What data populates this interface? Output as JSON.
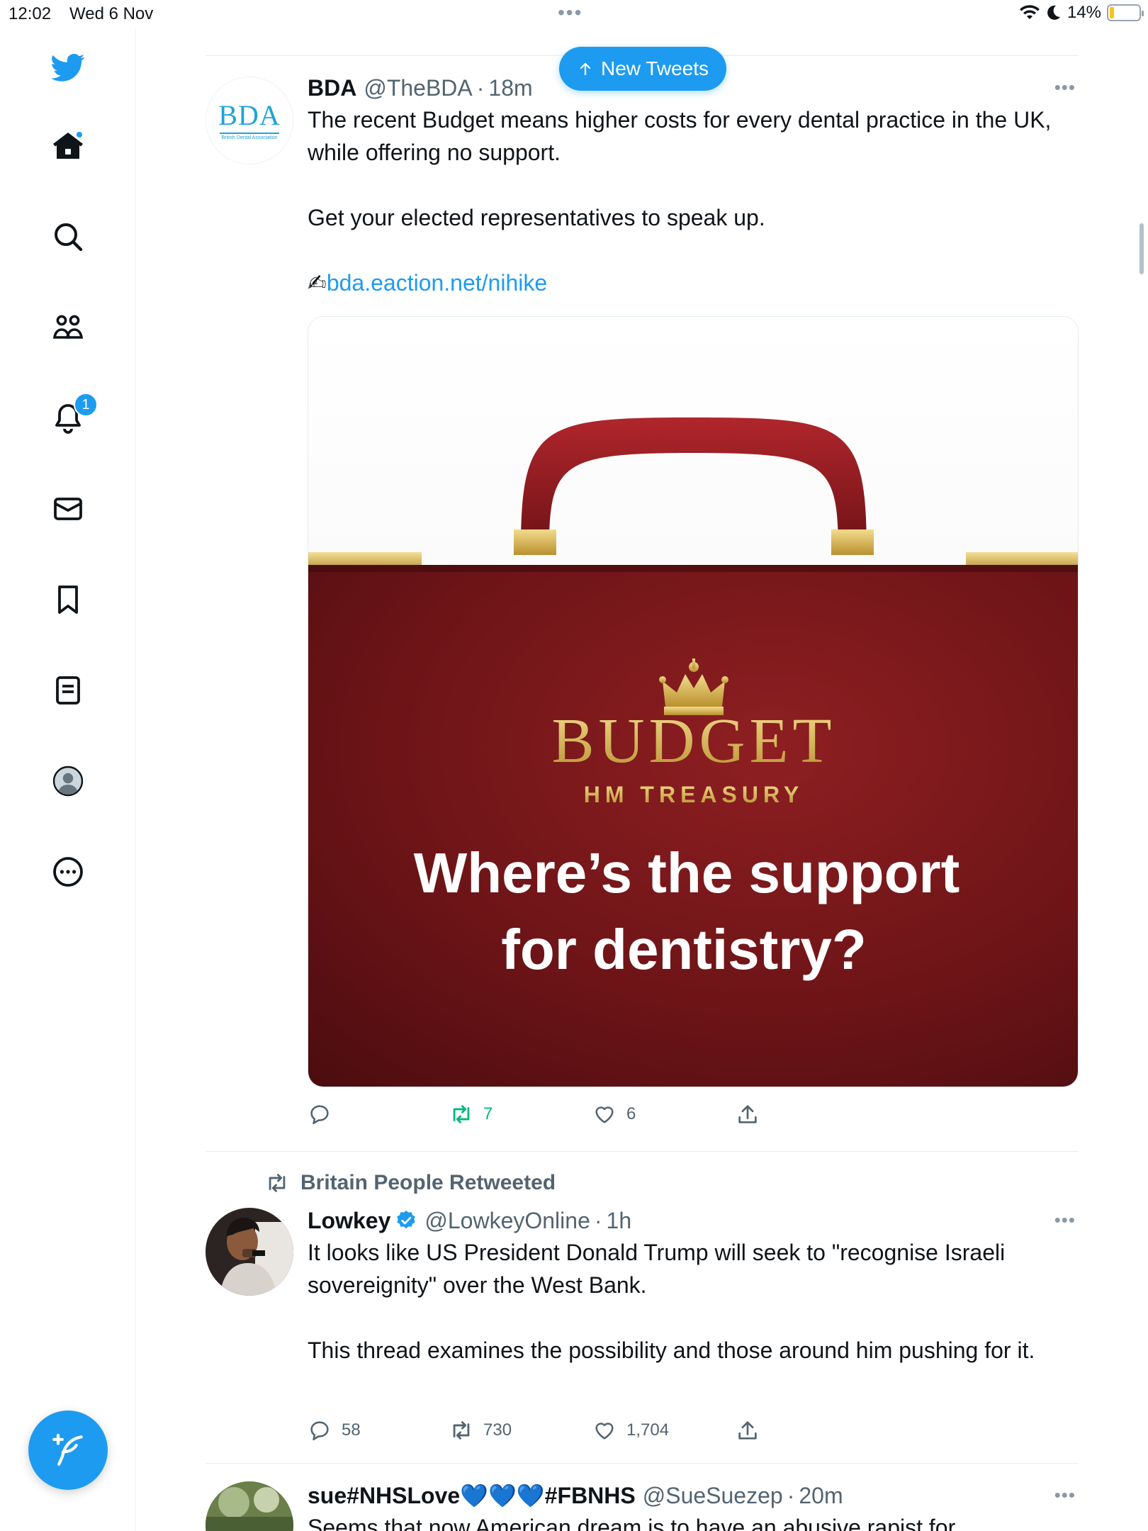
{
  "status_bar": {
    "time": "12:02",
    "date": "Wed 6 Nov",
    "battery_percent": "14%",
    "battery_level": 0.14
  },
  "sidebar": {
    "items": [
      {
        "name": "home",
        "icon": "home-icon",
        "has_dot": true
      },
      {
        "name": "explore",
        "icon": "search-icon"
      },
      {
        "name": "communities",
        "icon": "people-icon"
      },
      {
        "name": "notifications",
        "icon": "bell-icon",
        "badge": "1"
      },
      {
        "name": "messages",
        "icon": "envelope-icon"
      },
      {
        "name": "bookmarks",
        "icon": "bookmark-icon"
      },
      {
        "name": "lists",
        "icon": "list-icon"
      },
      {
        "name": "profile",
        "icon": "profile-icon"
      },
      {
        "name": "more",
        "icon": "more-circle-icon"
      }
    ],
    "compose_icon": "feather-plus-icon"
  },
  "new_tweets_pill": {
    "label": "New Tweets",
    "icon": "arrow-up-icon"
  },
  "colors": {
    "accent": "#1d9bf0",
    "retweet_green": "#00ba7c",
    "secondary_text": "#536471"
  },
  "tweets": [
    {
      "author": "BDA",
      "handle": "@TheBDA",
      "time": "18m",
      "avatar_text": "BDA",
      "avatar_subtext": "British Dental Association",
      "text_lines": [
        "The recent Budget means higher costs for every dental practice in the UK, while offering no support.",
        "Get your elected representatives to speak up."
      ],
      "link_emoji": "✍",
      "link": "bda.eaction.net/nihike",
      "media": {
        "title": "BUDGET",
        "subtitle": "HM TREASURY",
        "headline_1": "Where’s the support",
        "headline_2": "for dentistry?"
      },
      "actions": {
        "replies": "",
        "retweets": "7",
        "likes": "6",
        "retweeted": true
      }
    },
    {
      "retweeted_by": "Britain People Retweeted",
      "author": "Lowkey",
      "verified": true,
      "handle": "@LowkeyOnline",
      "time": "1h",
      "text_lines": [
        "It looks like US President Donald Trump will seek to \"recognise Israeli sovereignity\" over the West Bank.",
        "This thread examines the possibility and those around him pushing for it."
      ],
      "actions": {
        "replies": "58",
        "retweets": "730",
        "likes": "1,704"
      }
    },
    {
      "author": "sue#NHSLove💙💙💙#FBNHS",
      "handle": "@SueSuezep",
      "time": "20m",
      "text_partial": "Seems that now American dream is to have an abusive rapist for"
    }
  ]
}
